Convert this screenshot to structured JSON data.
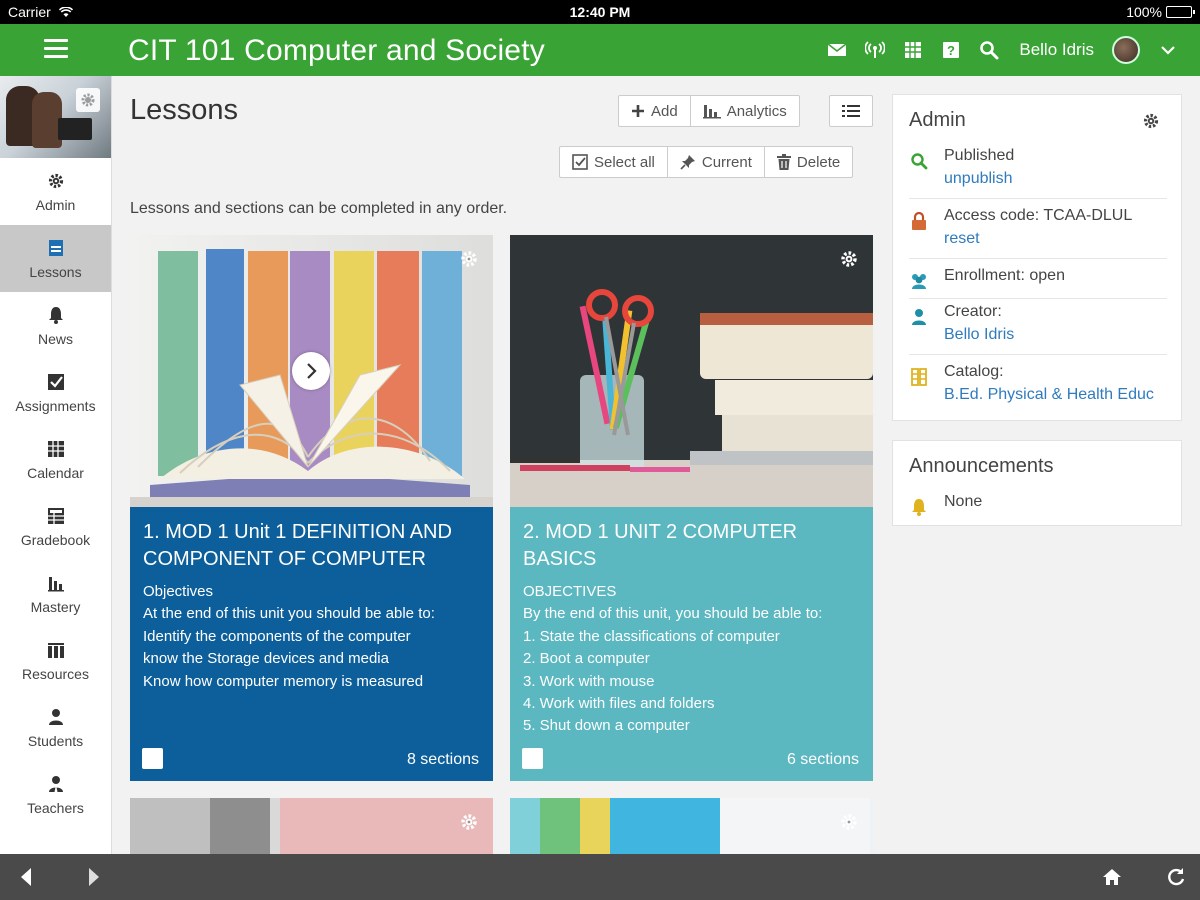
{
  "status": {
    "carrier": "Carrier",
    "time": "12:40 PM",
    "battery": "100%"
  },
  "header": {
    "course_title": "CIT 101 Computer and Society",
    "user_name": "Bello Idris"
  },
  "nav": {
    "items": [
      {
        "label": "Admin",
        "icon": "gear-icon"
      },
      {
        "label": "Lessons",
        "icon": "lessons-icon",
        "active": true
      },
      {
        "label": "News",
        "icon": "bell-icon"
      },
      {
        "label": "Assignments",
        "icon": "checkbox-icon"
      },
      {
        "label": "Calendar",
        "icon": "calendar-icon"
      },
      {
        "label": "Gradebook",
        "icon": "gradebook-icon"
      },
      {
        "label": "Mastery",
        "icon": "bar-chart-icon"
      },
      {
        "label": "Resources",
        "icon": "resources-icon"
      },
      {
        "label": "Students",
        "icon": "person-icon"
      },
      {
        "label": "Teachers",
        "icon": "teacher-icon"
      }
    ]
  },
  "main": {
    "title": "Lessons",
    "toolbar": {
      "add": "Add",
      "analytics": "Analytics",
      "select_all": "Select all",
      "current": "Current",
      "delete": "Delete"
    },
    "order_note": "Lessons and sections can be completed in any order.",
    "lessons": [
      {
        "title": "1. MOD 1 Unit 1 DEFINITION AND COMPONENT OF COMPUTER",
        "description": "Objectives\nAt the end of this unit you should be able to:\n Identify the components of the computer\n know the Storage devices and media\n Know how computer memory is measured",
        "sections": "8 sections"
      },
      {
        "title": "2. MOD 1 UNIT 2 COMPUTER BASICS",
        "description": "OBJECTIVES\nBy the end of this unit, you should be able to:\n1. State the classifications of computer\n2. Boot a computer\n3. Work with mouse\n4. Work with files and folders\n5. Shut down a computer",
        "sections": "6 sections"
      }
    ]
  },
  "admin": {
    "title": "Admin",
    "published_label": "Published",
    "unpublish_link": "unpublish",
    "access_code_label": "Access code: TCAA-DLUL",
    "reset_link": "reset",
    "enrollment_label": "Enrollment: open",
    "creator_label": "Creator:",
    "creator_link": "Bello Idris",
    "catalog_label": "Catalog:",
    "catalog_link": "B.Ed. Physical & Health Educ"
  },
  "announcements": {
    "title": "Announcements",
    "value": "None"
  },
  "colors": {
    "brand_green": "#3aa335",
    "lesson1": "#0c5f9a",
    "lesson2": "#5bb7c0",
    "link": "#2f7bbd"
  }
}
